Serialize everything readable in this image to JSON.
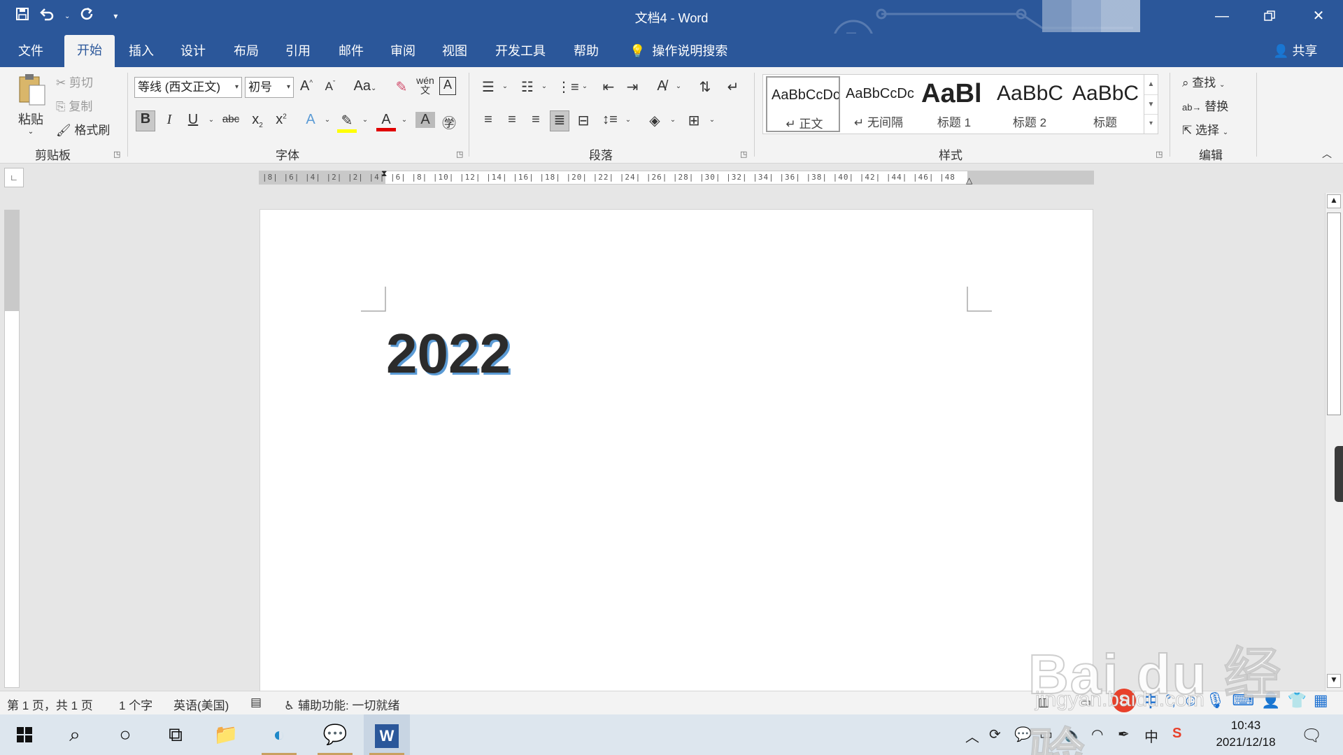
{
  "app": {
    "window_title": "文档4  -  Word",
    "accent_color": "#2b579a"
  },
  "qat": {
    "save_icon": "save-icon",
    "undo_icon": "undo-icon",
    "redo_icon": "redo-icon",
    "customize_icon": "customize-qat-icon"
  },
  "tabs": [
    {
      "label": "文件"
    },
    {
      "label": "开始"
    },
    {
      "label": "插入"
    },
    {
      "label": "设计"
    },
    {
      "label": "布局"
    },
    {
      "label": "引用"
    },
    {
      "label": "邮件"
    },
    {
      "label": "审阅"
    },
    {
      "label": "视图"
    },
    {
      "label": "开发工具"
    },
    {
      "label": "帮助"
    }
  ],
  "active_tab": "开始",
  "search": {
    "label": "操作说明搜索"
  },
  "share": {
    "label": "共享"
  },
  "clipboard": {
    "paste": "粘贴",
    "cut": "剪切",
    "copy": "复制",
    "format_painter": "格式刷",
    "group": "剪贴板"
  },
  "font": {
    "name": "等线 (西文正文)",
    "size": "初号",
    "group": "字体",
    "change_case": "Aa"
  },
  "paragraph": {
    "group": "段落"
  },
  "styles": {
    "group": "样式",
    "items": [
      {
        "sample": "AaBbCcDc",
        "name": "↵ 正文"
      },
      {
        "sample": "AaBbCcDc",
        "name": "↵ 无间隔"
      },
      {
        "sample": "AaBl",
        "name": "标题 1"
      },
      {
        "sample": "AaBbC",
        "name": "标题 2"
      },
      {
        "sample": "AaBbC",
        "name": "标题"
      }
    ]
  },
  "editing": {
    "find": "查找",
    "replace": "替换",
    "select": "选择",
    "group": "编辑"
  },
  "ruler": {
    "ticks": "|8|  |6|  |4|  |2|    |2|  |4|  |6|  |8|  |10|  |12|  |14|  |16|  |18|  |20|  |22|  |24|  |26|  |28|  |30|  |32|  |34|  |36|  |38|  |40|  |42|  |44|  |46|  |48"
  },
  "document": {
    "text": "2022"
  },
  "status": {
    "page": "第 1 页，共 1 页",
    "words": "1 个字",
    "language": "英语(美国)",
    "accessibility": "辅助功能: 一切就绪"
  },
  "ime": {
    "mode": "中",
    "punct": "°,"
  },
  "tray": {
    "time": "10:43",
    "date": "2021/12/18",
    "lang": "中"
  },
  "watermark": {
    "brand": "Bai  du 经验",
    "url": "jingyan.baidu.com"
  }
}
